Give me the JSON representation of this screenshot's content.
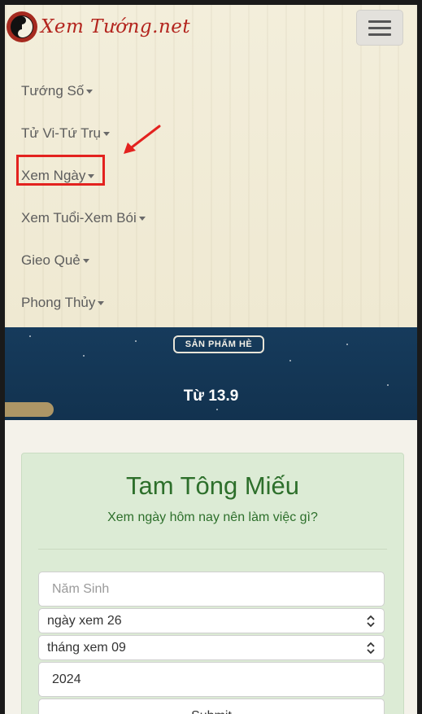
{
  "header": {
    "logo_text": "Xem Tướng.net",
    "menu_icon": "hamburger-icon"
  },
  "nav": {
    "items": [
      {
        "label": "Tướng Số"
      },
      {
        "label": "Tử Vi-Tứ Trụ"
      },
      {
        "label": "Xem Ngày"
      },
      {
        "label": "Xem Tuổi-Xem Bói"
      },
      {
        "label": "Gieo Quẻ"
      },
      {
        "label": "Phong Thủy"
      }
    ],
    "highlighted_item": "Xem Ngày",
    "annotation_color": "#e3221f"
  },
  "banner": {
    "badge": "SẢN PHẨM HÈ",
    "date_text": "Từ 13.9"
  },
  "card": {
    "title": "Tam Tông Miếu",
    "subtitle": "Xem ngày hôm nay nên làm việc gì?",
    "birth_year_placeholder": "Năm Sinh",
    "day_select": "ngày xem 26",
    "month_select": "tháng xem 09",
    "year_value": "2024",
    "submit_label": "Submit"
  },
  "colors": {
    "brand_red": "#b3241d",
    "card_green": "#dcebd5",
    "title_green": "#2d6f2b",
    "banner_blue": "#163b5c"
  }
}
